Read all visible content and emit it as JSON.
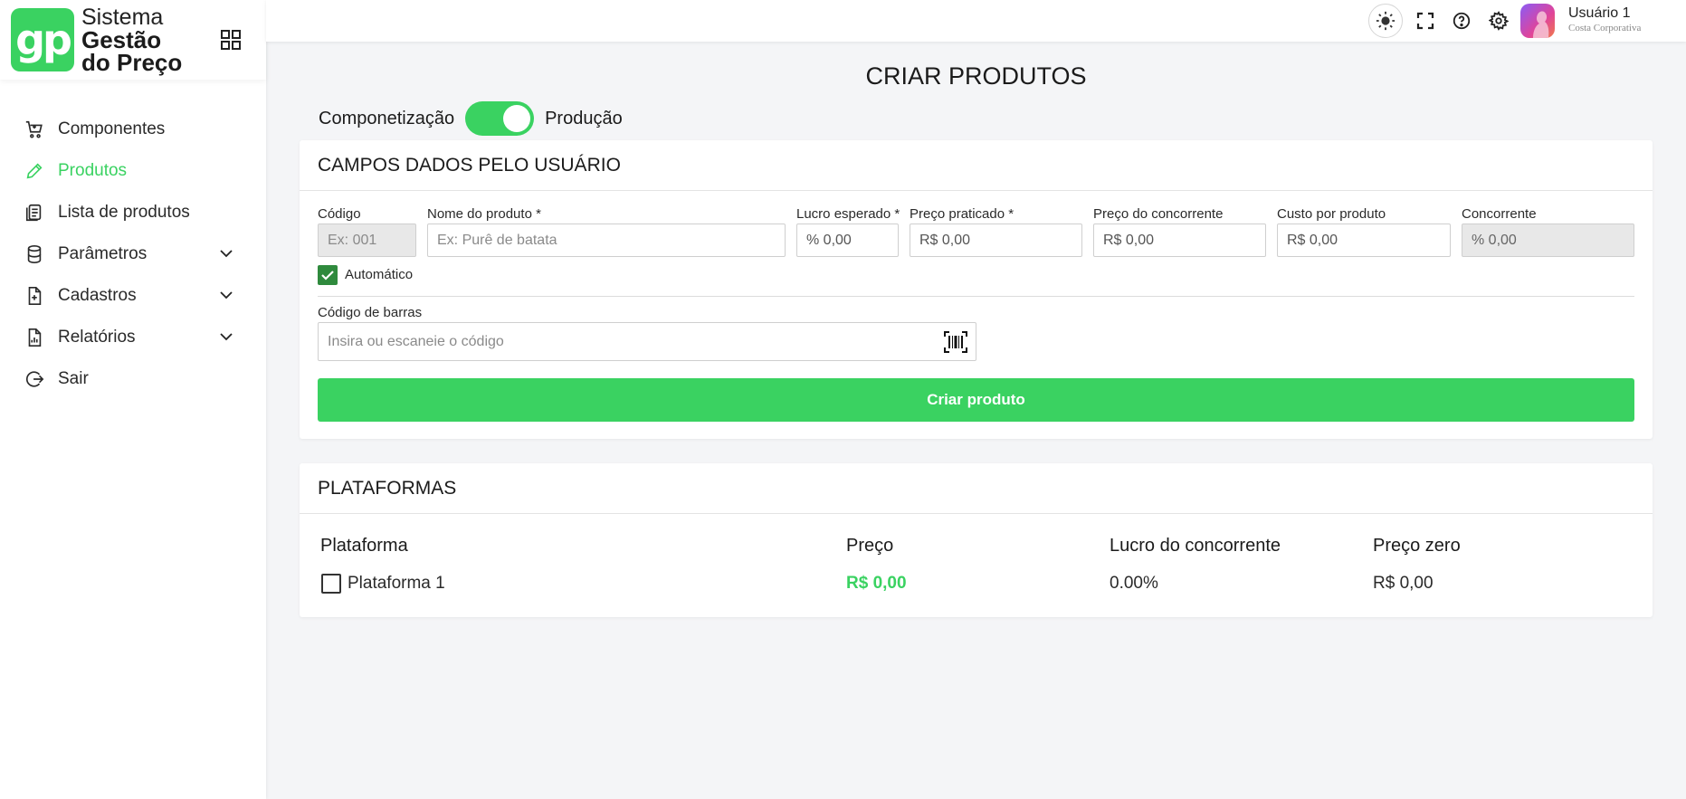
{
  "brand": {
    "logo_text": "gp",
    "line1": "Sistema",
    "line2": "Gestão",
    "line3": "do Preço"
  },
  "sidebar": {
    "items": [
      {
        "label": "Componentes",
        "icon": "cart-icon",
        "active": false
      },
      {
        "label": "Produtos",
        "icon": "pencil-icon",
        "active": true
      },
      {
        "label": "Lista de produtos",
        "icon": "list-icon",
        "active": false
      },
      {
        "label": "Parâmetros",
        "icon": "database-icon",
        "active": false,
        "expandable": true
      },
      {
        "label": "Cadastros",
        "icon": "document-add-icon",
        "active": false,
        "expandable": true
      },
      {
        "label": "Relatórios",
        "icon": "report-icon",
        "active": false,
        "expandable": true
      },
      {
        "label": "Sair",
        "icon": "logout-icon",
        "active": false
      }
    ]
  },
  "topbar": {
    "user_name": "Usuário 1",
    "user_org": "Costa Corporativa"
  },
  "page": {
    "title": "CRIAR PRODUTOS",
    "toggle_left": "Componetização",
    "toggle_right": "Produção",
    "toggle_on": true
  },
  "form": {
    "section_title": "CAMPOS DADOS PELO USUÁRIO",
    "codigo": {
      "label": "Código",
      "placeholder": "Ex: 001"
    },
    "nome": {
      "label": "Nome do produto *",
      "placeholder": "Ex: Purê de batata"
    },
    "lucro": {
      "label": "Lucro esperado *",
      "value": "% 0,00"
    },
    "preco_praticado": {
      "label": "Preço praticado *",
      "value": "R$ 0,00"
    },
    "preco_concorrente": {
      "label": "Preço do concorrente",
      "value": "R$ 0,00"
    },
    "custo": {
      "label": "Custo por produto",
      "value": "R$ 0,00"
    },
    "concorrente": {
      "label": "Concorrente",
      "value": "% 0,00"
    },
    "automatico": {
      "label": "Automático",
      "checked": true
    },
    "barcode": {
      "label": "Código de barras",
      "placeholder": "Insira ou escaneie o código"
    },
    "submit_label": "Criar produto"
  },
  "platforms": {
    "section_title": "PLATAFORMAS",
    "headers": [
      "Plataforma",
      "Preço",
      "Lucro do concorrente",
      "Preço zero"
    ],
    "rows": [
      {
        "name": "Plataforma 1",
        "preco": "R$ 0,00",
        "lucro": "0.00%",
        "preco_zero": "R$ 0,00",
        "checked": false
      }
    ]
  },
  "colors": {
    "accent": "#3ad261",
    "checkbox": "#2f8a3d"
  }
}
